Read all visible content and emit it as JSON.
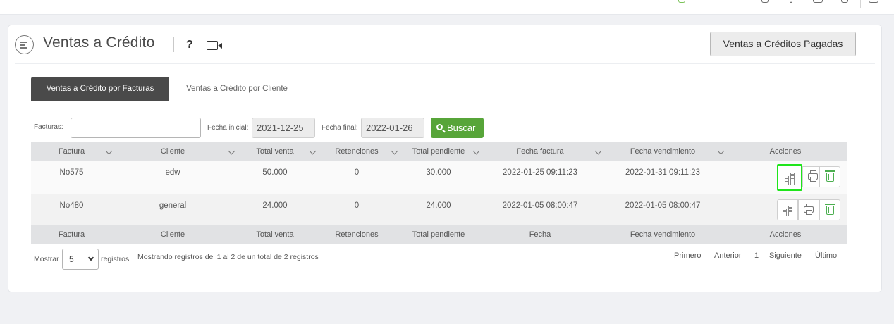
{
  "header": {
    "title": "Ventas a Crédito",
    "help_label": "?",
    "paid_button_label": "Ventas a Créditos Pagadas"
  },
  "tabs": [
    {
      "label": "Ventas a Crédito por Facturas",
      "active": true
    },
    {
      "label": "Ventas a Crédito por Cliente",
      "active": false
    }
  ],
  "filters": {
    "facturas_label": "Facturas:",
    "facturas_value": "",
    "fecha_inicial_label": "Fecha inicial:",
    "fecha_inicial_value": "2021-12-25",
    "fecha_final_label": "Fecha final:",
    "fecha_final_value": "2022-01-26",
    "search_label": "Buscar"
  },
  "table": {
    "columns": [
      "Factura",
      "Cliente",
      "Total venta",
      "Retenciones",
      "Total pendiente",
      "Fecha factura",
      "Fecha vencimiento",
      "Acciones"
    ],
    "footer_columns": [
      "Factura",
      "Cliente",
      "Total venta",
      "Retenciones",
      "Total pendiente",
      "Fecha",
      "Fecha vencimiento",
      "Acciones"
    ],
    "rows": [
      {
        "factura": "No575",
        "cliente": "edw",
        "total_venta": "50.000",
        "retenciones": "0",
        "total_pendiente": "30.000",
        "fecha_factura": "2022-01-25 09:11:23",
        "fecha_vencimiento": "2022-01-31 09:11:23"
      },
      {
        "factura": "No480",
        "cliente": "general",
        "total_venta": "24.000",
        "retenciones": "0",
        "total_pendiente": "24.000",
        "fecha_factura": "2022-01-05 08:00:47",
        "fecha_vencimiento": "2022-01-05 08:00:47"
      }
    ]
  },
  "pagination": {
    "show_label": "Mostrar",
    "page_size": "5",
    "records_label": "registros",
    "info": "Mostrando registros del 1 al 2 de un total de 2 registros",
    "first": "Primero",
    "previous": "Anterior",
    "current_page": "1",
    "next": "Siguiente",
    "last": "Último"
  },
  "colors": {
    "search_button": "#57a539",
    "active_tab": "#4a4a4a",
    "highlight": "#1fe51b",
    "trash_icon": "#4caf50"
  }
}
